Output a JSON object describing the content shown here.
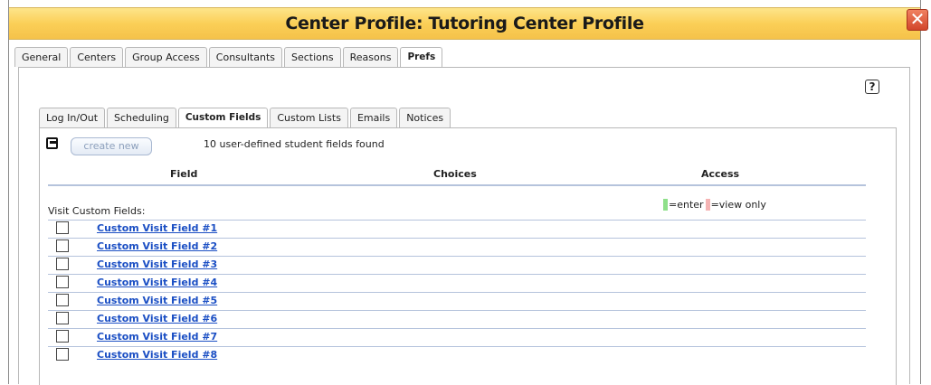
{
  "window": {
    "title": "Center Profile: Tutoring Center Profile",
    "close_label": "✕"
  },
  "main_tabs": [
    {
      "label": "General",
      "active": false
    },
    {
      "label": "Centers",
      "active": false
    },
    {
      "label": "Group Access",
      "active": false
    },
    {
      "label": "Consultants",
      "active": false
    },
    {
      "label": "Sections",
      "active": false
    },
    {
      "label": "Reasons",
      "active": false
    },
    {
      "label": "Prefs",
      "active": true
    }
  ],
  "help": {
    "label": "?"
  },
  "sub_tabs": [
    {
      "label": "Log In/Out",
      "active": false
    },
    {
      "label": "Scheduling",
      "active": false
    },
    {
      "label": "Custom Fields",
      "active": true
    },
    {
      "label": "Custom Lists",
      "active": false
    },
    {
      "label": "Emails",
      "active": false
    },
    {
      "label": "Notices",
      "active": false
    }
  ],
  "toolbar": {
    "create_label": "create new",
    "found_text": "10 user-defined student fields found"
  },
  "table": {
    "headers": {
      "field": "Field",
      "choices": "Choices",
      "access": "Access"
    },
    "legend": {
      "enter_label": "=enter",
      "view_label": "=view only",
      "enter_color": "#8fe08a",
      "view_color": "#f5b3b3"
    },
    "section_label": "Visit Custom Fields:",
    "rows": [
      {
        "label": "Custom Visit Field #1"
      },
      {
        "label": "Custom Visit Field #2"
      },
      {
        "label": "Custom Visit Field #3"
      },
      {
        "label": "Custom Visit Field #4"
      },
      {
        "label": "Custom Visit Field #5"
      },
      {
        "label": "Custom Visit Field #6"
      },
      {
        "label": "Custom Visit Field #7"
      },
      {
        "label": "Custom Visit Field #8"
      }
    ]
  },
  "colors": {
    "title_bar": "#fbcf57",
    "link": "#1b4fc4",
    "close": "#d2462b"
  }
}
